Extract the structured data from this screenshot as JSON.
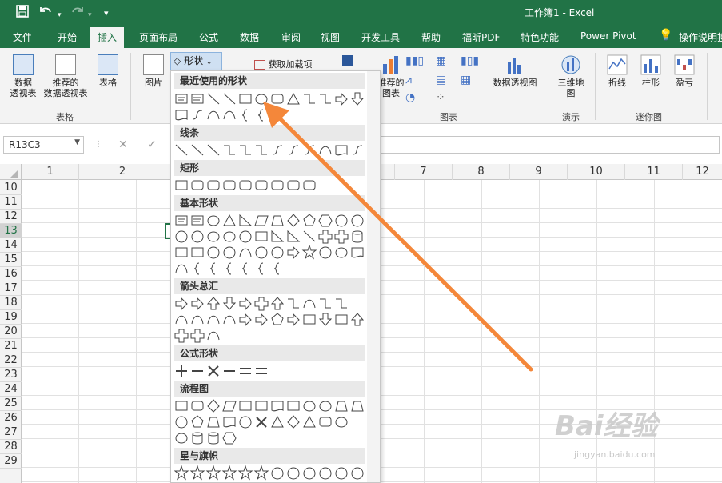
{
  "titlebar": {
    "doc_title": "工作簿1 - Excel",
    "save_icon": "save-icon",
    "undo_icon": "undo-icon",
    "redo_icon": "redo-icon"
  },
  "tabs": [
    "文件",
    "开始",
    "插入",
    "页面布局",
    "公式",
    "数据",
    "审阅",
    "视图",
    "开发工具",
    "帮助",
    "福昕PDF",
    "特色功能",
    "Power Pivot",
    "操作说明搜"
  ],
  "active_tab": "插入",
  "ribbon": {
    "pivot_line1": "数据",
    "pivot_line2": "透视表",
    "rec_line1": "推荐的",
    "rec_line2": "数据透视表",
    "table": "表格",
    "group_tables": "表格",
    "illustrations": "图片",
    "shapes_button": "形状",
    "addins": "获取加载项",
    "rec_charts_line1": "推荐的",
    "rec_charts_line2": "图表",
    "pivot_chart": "数据透视图",
    "map_line1": "三维地",
    "map_line2": "图",
    "group_charts": "图表",
    "group_tours": "演示",
    "spark_line": "折线",
    "spark_col": "柱形",
    "spark_wl": "盈亏",
    "group_sparklines": "迷你图"
  },
  "formula_bar": {
    "name_box": "R13C3",
    "cancel": "✕",
    "enter": "✓",
    "value": ""
  },
  "columns": [
    "1",
    "2",
    "",
    "",
    "",
    "",
    "",
    "7",
    "8",
    "9",
    "10",
    "11",
    "12"
  ],
  "rows": [
    "10",
    "11",
    "12",
    "13",
    "14",
    "15",
    "16",
    "17",
    "18",
    "19",
    "20",
    "21",
    "22",
    "23",
    "24",
    "25",
    "26",
    "27",
    "28",
    "29"
  ],
  "selected_row": "13",
  "shapes_menu": {
    "recent": "最近使用的形状",
    "lines": "线条",
    "rectangles": "矩形",
    "basic": "基本形状",
    "arrows": "箭头总汇",
    "equation": "公式形状",
    "flowchart": "流程图",
    "stars": "星与旗帜"
  },
  "watermark": {
    "main": "Bai经验",
    "sub": "jingyan.baidu.com"
  },
  "colors": {
    "excel_green": "#217346",
    "arrow": "#f4873a",
    "panel_header": "#e9e9e9"
  }
}
